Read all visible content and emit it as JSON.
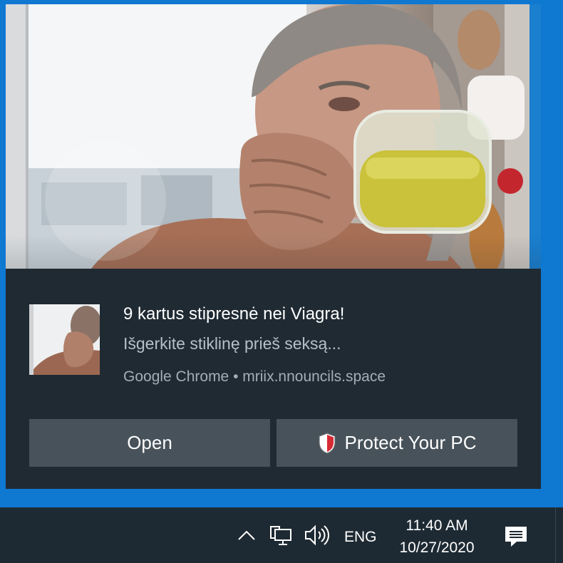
{
  "notification": {
    "title": "9 kartus stipresnė nei Viagra!",
    "body": "Išgerkite stiklinę prieš seksą...",
    "source": "Google Chrome • mriix.nnouncils.space",
    "image_subject": "elderly-man-drinking-from-glass-jar",
    "buttons": {
      "open_label": "Open",
      "protect_label": "Protect Your PC"
    }
  },
  "taskbar": {
    "language": "ENG",
    "time": "11:40 AM",
    "date": "10/27/2020",
    "icons": [
      "chevron-up-icon",
      "network-icon",
      "volume-icon",
      "action-center-icon"
    ]
  },
  "colors": {
    "desktop_blue": "#0f78d1",
    "toast_bg": "#1f2a33",
    "button_bg": "#47525a",
    "taskbar_bg": "#1e2a33",
    "shield_red": "#d62b35"
  }
}
